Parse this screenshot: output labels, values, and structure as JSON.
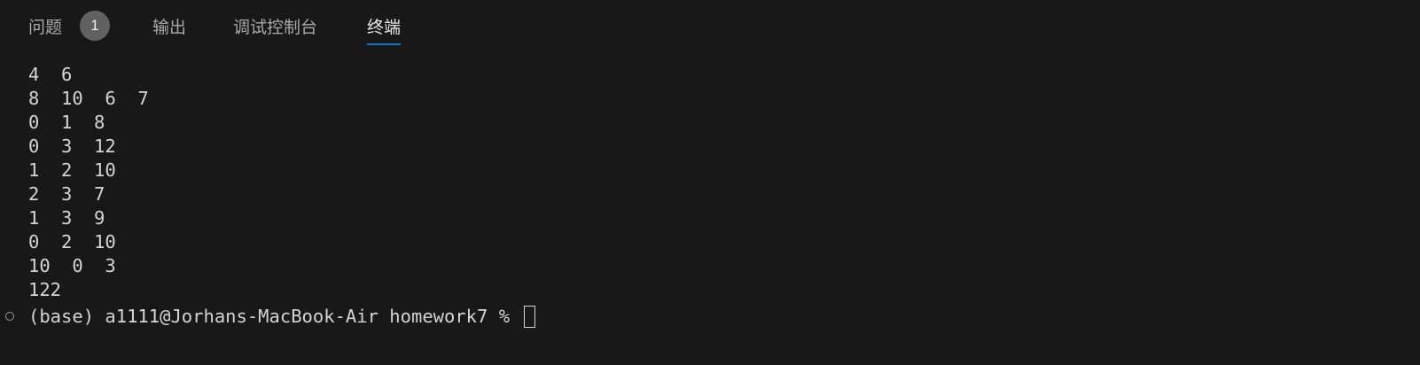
{
  "tabs": {
    "problems": {
      "label": "问题",
      "badge": "1"
    },
    "output": {
      "label": "输出"
    },
    "debug_console": {
      "label": "调试控制台"
    },
    "terminal": {
      "label": "终端",
      "active": true
    }
  },
  "terminal": {
    "lines": [
      "4  6",
      "8  10  6  7",
      "0  1  8",
      "0  3  12",
      "1  2  10",
      "2  3  7",
      "1  3  9",
      "0  2  10",
      "10  0  3",
      "122"
    ],
    "prompt": "(base) a1111@Jorhans-MacBook-Air homework7 % "
  },
  "colors": {
    "background": "#181818",
    "active_tab_underline": "#0078d4",
    "badge": "#616161"
  }
}
